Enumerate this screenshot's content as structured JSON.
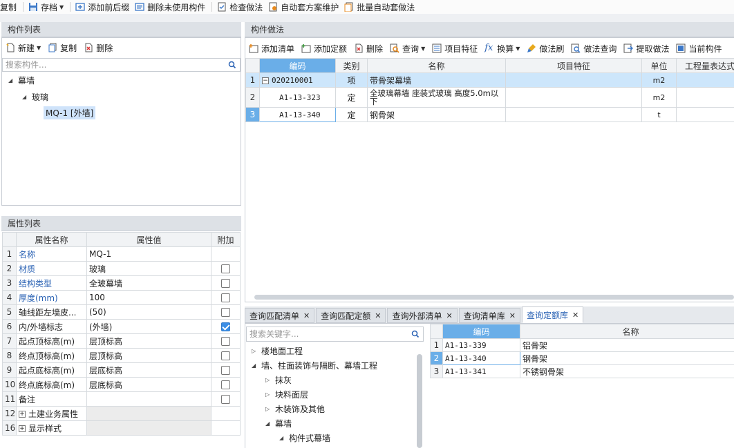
{
  "toolbar": {
    "items": [
      {
        "label": "复制",
        "icon": "copy-icon"
      },
      {
        "label": "存档",
        "icon": "save-icon",
        "dropdown": true
      },
      {
        "label": "添加前后缀",
        "icon": "add-prefix-icon"
      },
      {
        "label": "删除未使用构件",
        "icon": "delete-unused-icon"
      },
      {
        "label": "检查做法",
        "icon": "check-method-icon"
      },
      {
        "label": "自动套方案维护",
        "icon": "auto-scheme-icon"
      },
      {
        "label": "批量自动套做法",
        "icon": "batch-auto-icon"
      }
    ]
  },
  "component_list": {
    "title": "构件列表",
    "toolbar": {
      "new_label": "新建",
      "copy_label": "复制",
      "delete_label": "删除"
    },
    "search": {
      "placeholder": "搜索构件..."
    },
    "tree": {
      "root": "幕墙",
      "child": "玻璃",
      "leaf": "MQ-1 [外墙]"
    }
  },
  "property_list": {
    "title": "属性列表",
    "headers": {
      "name": "属性名称",
      "value": "属性值",
      "extra": "附加"
    },
    "rows": [
      {
        "num": "1",
        "name": "名称",
        "value": "MQ-1",
        "blue": true,
        "checkbox": "none"
      },
      {
        "num": "2",
        "name": "材质",
        "value": "玻璃",
        "blue": true,
        "checkbox": "unchecked"
      },
      {
        "num": "3",
        "name": "结构类型",
        "value": "全玻幕墙",
        "blue": true,
        "checkbox": "unchecked"
      },
      {
        "num": "4",
        "name": "厚度(mm)",
        "value": "100",
        "blue": true,
        "checkbox": "unchecked"
      },
      {
        "num": "5",
        "name": "轴线距左墙皮...",
        "value": "(50)",
        "blue": false,
        "checkbox": "unchecked"
      },
      {
        "num": "6",
        "name": "内/外墙标志",
        "value": "(外墙)",
        "blue": false,
        "checkbox": "checked"
      },
      {
        "num": "7",
        "name": "起点顶标高(m)",
        "value": "层顶标高",
        "blue": false,
        "checkbox": "unchecked"
      },
      {
        "num": "8",
        "name": "终点顶标高(m)",
        "value": "层顶标高",
        "blue": false,
        "checkbox": "unchecked"
      },
      {
        "num": "9",
        "name": "起点底标高(m)",
        "value": "层底标高",
        "blue": false,
        "checkbox": "unchecked"
      },
      {
        "num": "10",
        "name": "终点底标高(m)",
        "value": "层底标高",
        "blue": false,
        "checkbox": "unchecked"
      },
      {
        "num": "11",
        "name": "备注",
        "value": "",
        "blue": false,
        "checkbox": "unchecked"
      },
      {
        "num": "12",
        "name": "土建业务属性",
        "value": "",
        "blue": false,
        "checkbox": "none",
        "group": true
      },
      {
        "num": "16",
        "name": "显示样式",
        "value": "",
        "blue": false,
        "checkbox": "none",
        "group": true
      }
    ]
  },
  "component_method": {
    "title": "构件做法",
    "toolbar": {
      "add_list": "添加清单",
      "add_quota": "添加定额",
      "delete": "删除",
      "query": "查询",
      "item_feature": "项目特征",
      "convert": "换算",
      "method_brush": "做法刷",
      "method_query": "做法查询",
      "extract": "提取做法",
      "current": "当前构件"
    },
    "headers": {
      "code": "编码",
      "type": "类别",
      "name": "名称",
      "feature": "项目特征",
      "unit": "单位",
      "expr": "工程量表达式"
    },
    "rows": [
      {
        "num": "1",
        "code": "020210001",
        "type": "项",
        "name": "带骨架幕墙",
        "feature": "",
        "unit": "m2"
      },
      {
        "num": "2",
        "code": "A1-13-323",
        "type": "定",
        "name": "全玻璃幕墙 座装式玻璃 高度5.0m以下",
        "feature": "",
        "unit": "m2"
      },
      {
        "num": "3",
        "code": "A1-13-340",
        "type": "定",
        "name": "钢骨架",
        "feature": "",
        "unit": "t"
      }
    ]
  },
  "query_tabs": {
    "tabs": [
      "查询匹配清单",
      "查询匹配定额",
      "查询外部清单",
      "查询清单库",
      "查询定额库"
    ],
    "active": 4,
    "search": {
      "placeholder": "搜索关键字..."
    },
    "tree": [
      {
        "label": "楼地面工程",
        "level": 0,
        "state": "collapsed"
      },
      {
        "label": "墙、柱面装饰与隔断、幕墙工程",
        "level": 0,
        "state": "expanded"
      },
      {
        "label": "抹灰",
        "level": 1,
        "state": "collapsed"
      },
      {
        "label": "块料面层",
        "level": 1,
        "state": "collapsed"
      },
      {
        "label": "木装饰及其他",
        "level": 1,
        "state": "collapsed"
      },
      {
        "label": "幕墙",
        "level": 1,
        "state": "expanded"
      },
      {
        "label": "构件式幕墙",
        "level": 2,
        "state": "expanded"
      }
    ],
    "result_headers": {
      "code": "编码",
      "name": "名称"
    },
    "results": [
      {
        "num": "1",
        "code": "A1-13-339",
        "name": "铝骨架"
      },
      {
        "num": "2",
        "code": "A1-13-340",
        "name": "钢骨架"
      },
      {
        "num": "3",
        "code": "A1-13-341",
        "name": "不锈钢骨架"
      }
    ]
  },
  "colors": {
    "accent": "#2a62b4",
    "header_selected": "#6aaee8",
    "row_selected": "#cde6fb"
  }
}
